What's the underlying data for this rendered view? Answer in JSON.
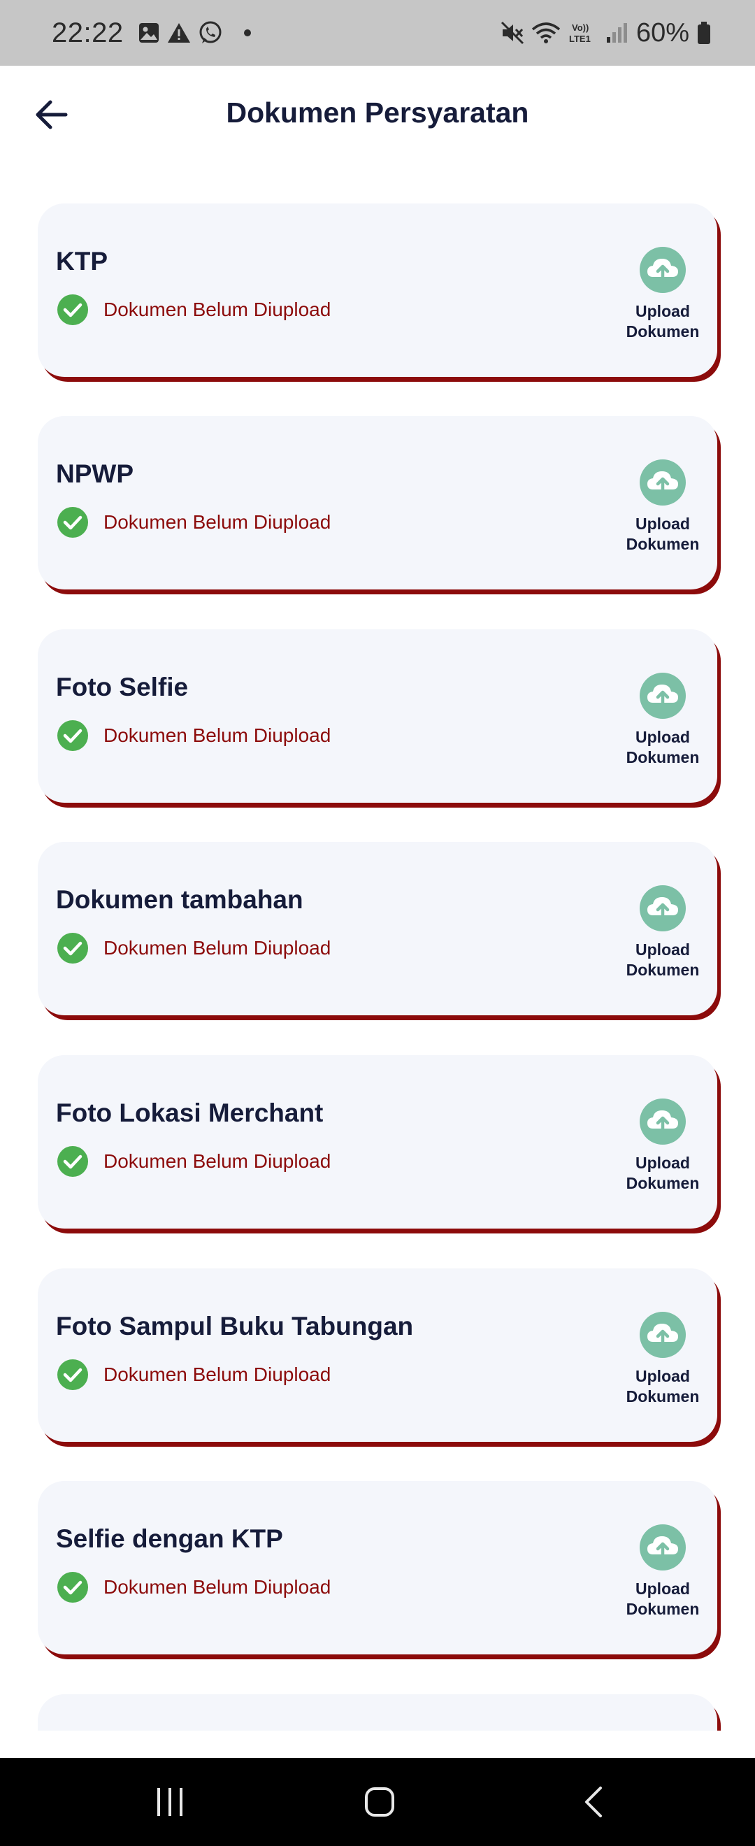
{
  "status_bar": {
    "time": "22:22",
    "battery": "60%",
    "icons": [
      "image-icon",
      "warning-icon",
      "whatsapp-icon",
      "mute-icon",
      "wifi-icon",
      "volte-icon",
      "signal-icon",
      "battery-icon"
    ]
  },
  "header": {
    "title": "Dokumen Persyaratan",
    "back_icon": "arrow-left-icon"
  },
  "documents": [
    {
      "title": "KTP",
      "status": "Dokumen Belum Diupload",
      "upload_label": "Upload\nDokumen"
    },
    {
      "title": "NPWP",
      "status": "Dokumen Belum Diupload",
      "upload_label": "Upload\nDokumen"
    },
    {
      "title": "Foto Selfie",
      "status": "Dokumen Belum Diupload",
      "upload_label": "Upload\nDokumen"
    },
    {
      "title": "Dokumen tambahan",
      "status": "Dokumen Belum Diupload",
      "upload_label": "Upload\nDokumen"
    },
    {
      "title": "Foto Lokasi Merchant",
      "status": "Dokumen Belum Diupload",
      "upload_label": "Upload\nDokumen"
    },
    {
      "title": "Foto Sampul Buku Tabungan",
      "status": "Dokumen Belum Diupload",
      "upload_label": "Upload\nDokumen"
    },
    {
      "title": "Selfie dengan KTP",
      "status": "Dokumen Belum Diupload",
      "upload_label": "Upload\nDokumen"
    }
  ],
  "colors": {
    "title_text": "#161c3a",
    "status_text": "#8c0b0b",
    "card_shadow": "#8c0b0b",
    "card_bg": "#f4f6fb",
    "check_green": "#4caf50",
    "upload_teal": "#7cc0a6"
  },
  "nav": {
    "icons": [
      "recent-apps-icon",
      "home-icon",
      "back-icon"
    ]
  }
}
